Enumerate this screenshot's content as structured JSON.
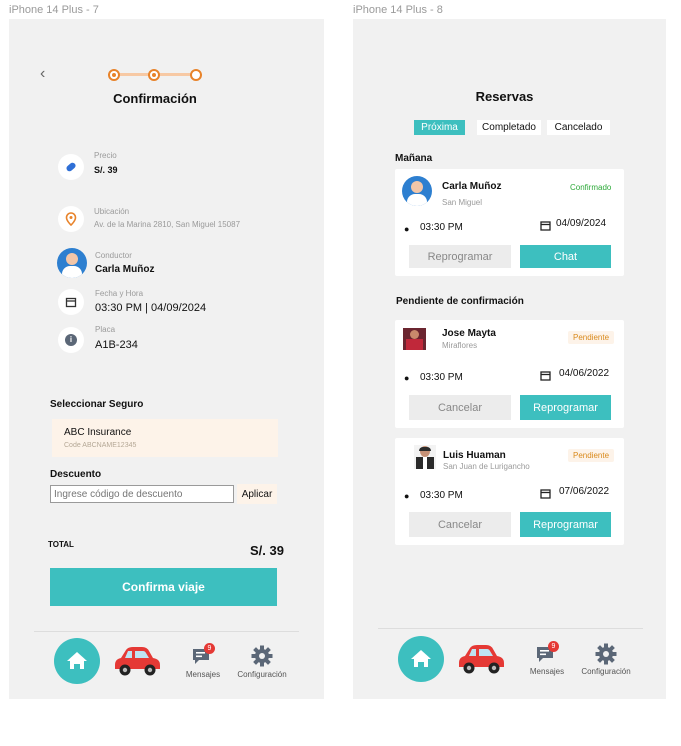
{
  "frames": {
    "left_title": "iPhone 14 Plus - 7",
    "right_title": "iPhone 14 Plus - 8"
  },
  "confirm": {
    "title": "Confirmación",
    "price_label": "Precio",
    "price_value": "S/. 39",
    "location_label": "Ubicación",
    "location_value": "Av. de la Marina 2810, San Miguel 15087",
    "driver_label": "Conductor",
    "driver_value": "Carla Muñoz",
    "datetime_label": "Fecha y Hora",
    "datetime_value": "03:30 PM | 04/09/2024",
    "plate_label": "Placa",
    "plate_value": "A1B-234",
    "insurance_heading": "Seleccionar Seguro",
    "insurance_name": "ABC Insurance",
    "insurance_code": "Code ABCNAME12345",
    "discount_heading": "Descuento",
    "discount_placeholder": "Ingrese código de descuento",
    "apply_label": "Aplicar",
    "total_label": "TOTAL",
    "total_value": "S/. 39",
    "confirm_button": "Confirma viaje"
  },
  "reservations": {
    "title": "Reservas",
    "tabs": [
      "Próxima",
      "Completado",
      "Cancelado"
    ],
    "section_tomorrow": "Mañana",
    "section_pending": "Pendiente de confirmación",
    "cards": [
      {
        "name": "Carla Muñoz",
        "place": "San Miguel",
        "status": "Confirmado",
        "time": "03:30 PM",
        "date": "04/09/2024",
        "btn_left": "Reprogramar",
        "btn_right": "Chat"
      },
      {
        "name": "Jose Mayta",
        "place": "Miraflores",
        "status": "Pendiente",
        "time": "03:30 PM",
        "date": "04/06/2022",
        "btn_left": "Cancelar",
        "btn_right": "Reprogramar"
      },
      {
        "name": "Luis Huaman",
        "place": "San Juan de Lurigancho",
        "status": "Pendiente",
        "time": "03:30 PM",
        "date": "07/06/2022",
        "btn_left": "Cancelar",
        "btn_right": "Reprogramar"
      }
    ]
  },
  "nav": {
    "messages_label": "Mensajes",
    "settings_label": "Configuración",
    "badge_count": "9"
  },
  "colors": {
    "teal": "#3dbfbf",
    "orange": "#e8832a",
    "badge_red": "#e53935",
    "confirmed_green": "#2eaa3a",
    "pending_orange": "#d98a1c"
  }
}
